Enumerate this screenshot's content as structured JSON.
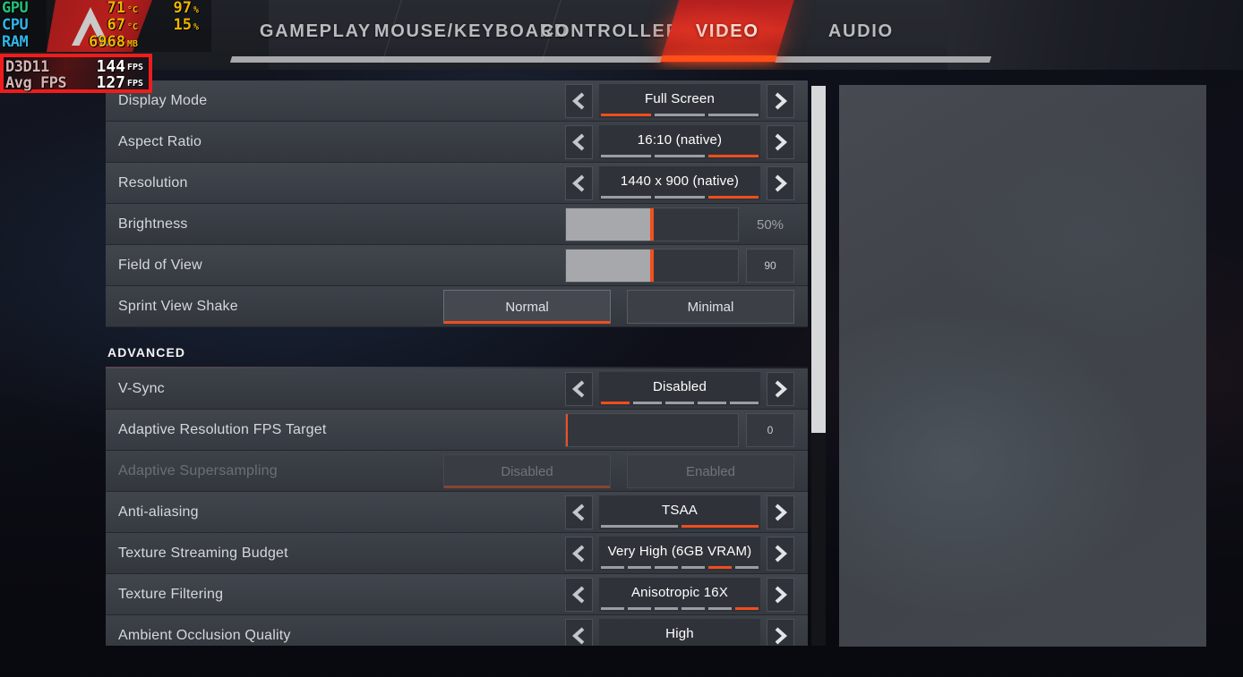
{
  "overlay": {
    "hw_rows": [
      {
        "label": "GPU",
        "color": "#23c17a",
        "v1": "71",
        "u1": "°C",
        "v2": "97",
        "u2": "%"
      },
      {
        "label": "CPU",
        "color": "#2fb5e8",
        "v1": "67",
        "u1": "°C",
        "v2": "15",
        "u2": "%"
      },
      {
        "label": "RAM",
        "color": "#2fb5e8",
        "v1": "6968",
        "u1": "MB",
        "v2": "",
        "u2": ""
      }
    ],
    "fps_rows": [
      {
        "label": "D3D11",
        "value": "144",
        "unit": "FPS"
      },
      {
        "label": "Avg FPS",
        "value": "127",
        "unit": "FPS"
      }
    ],
    "accent_border": "#f01c1c"
  },
  "tabs": {
    "active": "VIDEO",
    "items": [
      {
        "label": "GAMEPLAY"
      },
      {
        "label": "MOUSE/KEYBOARD"
      },
      {
        "label": "CONTROLLER"
      },
      {
        "label": "VIDEO"
      },
      {
        "label": "AUDIO"
      }
    ]
  },
  "settings": {
    "rows": [
      {
        "kind": "stepper",
        "label": "Display Mode",
        "value": "Full Screen",
        "segments": 3,
        "active": 1
      },
      {
        "kind": "stepper",
        "label": "Aspect Ratio",
        "value": "16:10 (native)",
        "segments": 3,
        "active": 3
      },
      {
        "kind": "stepper",
        "label": "Resolution",
        "value": "1440 x 900 (native)",
        "segments": 3,
        "active": 3
      },
      {
        "kind": "slider",
        "label": "Brightness",
        "value": "50%",
        "percent": 50,
        "boxed": false
      },
      {
        "kind": "slider",
        "label": "Field of View",
        "value": "90",
        "percent": 50,
        "boxed": true
      },
      {
        "kind": "toggle",
        "label": "Sprint View Shake",
        "options": [
          "Normal",
          "Minimal"
        ],
        "selected": 0
      },
      {
        "kind": "section",
        "label": "ADVANCED"
      },
      {
        "kind": "stepper",
        "label": "V-Sync",
        "value": "Disabled",
        "segments": 5,
        "active": 1
      },
      {
        "kind": "slider",
        "label": "Adaptive Resolution FPS Target",
        "value": "0",
        "percent": 0,
        "boxed": true
      },
      {
        "kind": "toggle",
        "label": "Adaptive Supersampling",
        "options": [
          "Disabled",
          "Enabled"
        ],
        "selected": 0,
        "disabled": true
      },
      {
        "kind": "stepper",
        "label": "Anti-aliasing",
        "value": "TSAA",
        "segments": 2,
        "active": 2
      },
      {
        "kind": "stepper",
        "label": "Texture Streaming Budget",
        "value": "Very High (6GB VRAM)",
        "segments": 6,
        "active": 5
      },
      {
        "kind": "stepper",
        "label": "Texture Filtering",
        "value": "Anisotropic 16X",
        "segments": 6,
        "active": 6
      },
      {
        "kind": "stepper",
        "label": "Ambient Occlusion Quality",
        "value": "High",
        "segments": 4,
        "active": 4
      }
    ]
  },
  "scrollbar": {
    "thumb_percent": 62
  },
  "colors": {
    "accent": "#f04d1e",
    "tab_active": "#c52a22",
    "panel": "#3b3f46"
  }
}
